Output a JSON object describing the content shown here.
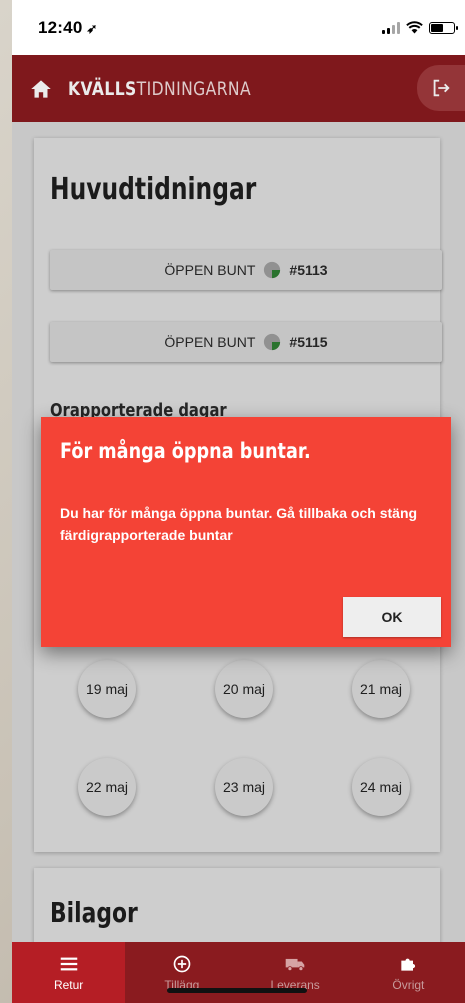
{
  "status_bar": {
    "time": "12:40",
    "location_glyph": "➶"
  },
  "header": {
    "brand_bold": "KVÄLLS",
    "brand_light": "TIDNINGARNA"
  },
  "main_card": {
    "title": "Huvudtidningar",
    "bundles": [
      {
        "label": "ÖPPEN BUNT",
        "number": "#5113"
      },
      {
        "label": "ÖPPEN BUNT",
        "number": "#5115"
      }
    ],
    "subheading": "Orapporterade dagar",
    "dates": [
      "19 maj",
      "20 maj",
      "21 maj",
      "22 maj",
      "23 maj",
      "24 maj"
    ]
  },
  "second_card": {
    "title": "Bilagor"
  },
  "dialog": {
    "title": "För många öppna buntar.",
    "message": "Du har för många öppna buntar. Gå tillbaka och stäng färdigrapporterade buntar",
    "ok_label": "OK"
  },
  "bottom_nav": {
    "items": [
      {
        "label": "Retur",
        "icon": "menu-icon",
        "active": true
      },
      {
        "label": "Tillägg",
        "icon": "plus-circle-icon",
        "active": false
      },
      {
        "label": "Leverans",
        "icon": "truck-icon",
        "active": false
      },
      {
        "label": "Övrigt",
        "icon": "puzzle-icon",
        "active": false
      }
    ]
  },
  "colors": {
    "brand_red": "#8a1b1f",
    "active_tab": "#b51e25",
    "dialog_red": "#f44336",
    "pie_green": "#2e7d32"
  }
}
